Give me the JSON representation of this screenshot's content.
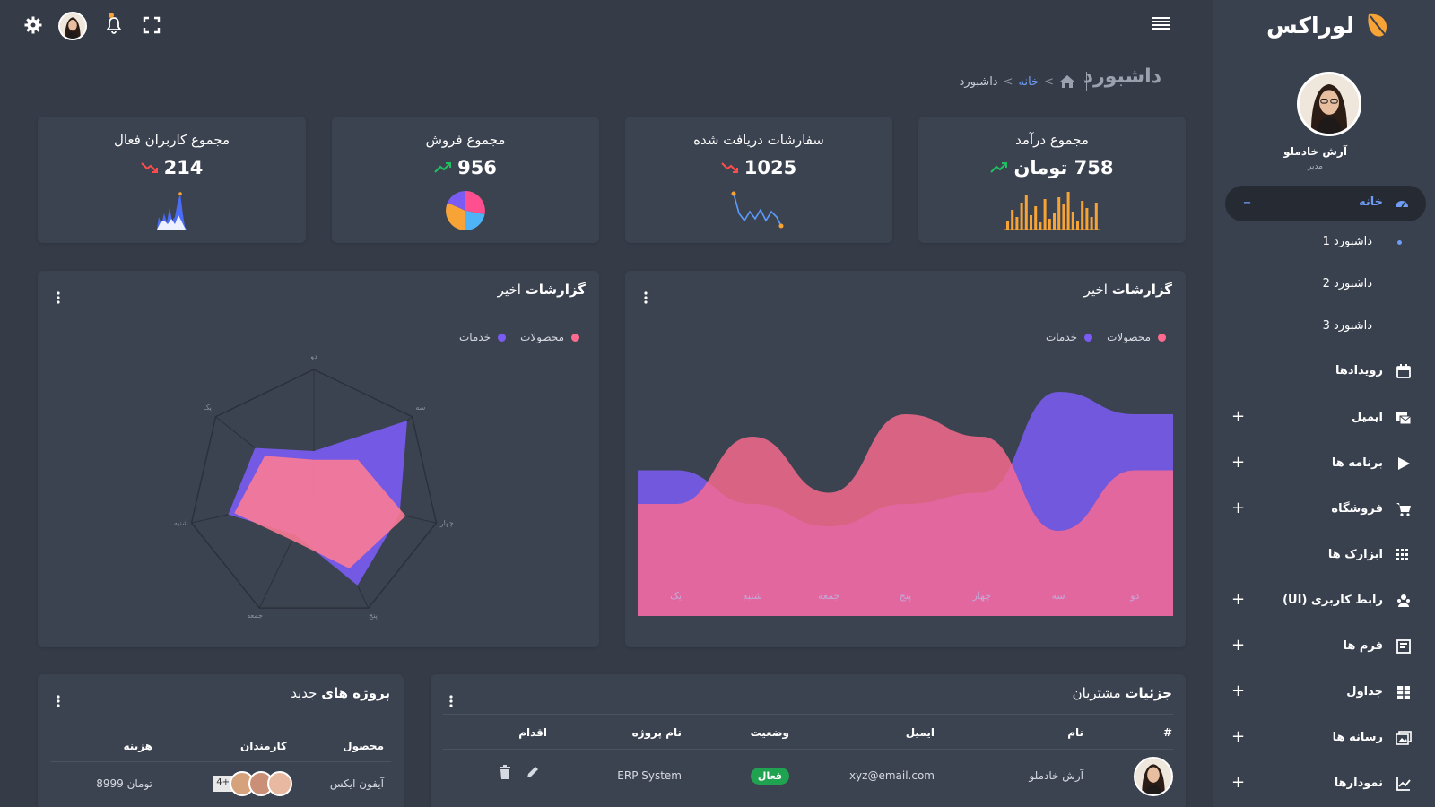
{
  "brand": {
    "name": "لوراکس"
  },
  "profile": {
    "name": "آرش خادملو",
    "role": "مدیر"
  },
  "sidebar": {
    "home": {
      "label": "خانه",
      "icon": "dashboard-icon"
    },
    "subitems": [
      {
        "label": "داشبورد 1"
      },
      {
        "label": "داشبورد 2"
      },
      {
        "label": "داشبورد 3"
      }
    ],
    "items": [
      {
        "label": "رویدادها",
        "icon": "calendar-icon",
        "expandable": false
      },
      {
        "label": "ایمیل",
        "icon": "email-icon",
        "expandable": true
      },
      {
        "label": "برنامه ها",
        "icon": "apps-icon",
        "expandable": true
      },
      {
        "label": "فروشگاه",
        "icon": "cart-icon",
        "expandable": true
      },
      {
        "label": "ابزارک ها",
        "icon": "widgets-icon",
        "expandable": false
      },
      {
        "label": "رابط کاربری (UI)",
        "icon": "ui-icon",
        "expandable": true
      },
      {
        "label": "فرم ها",
        "icon": "forms-icon",
        "expandable": true
      },
      {
        "label": "جداول",
        "icon": "table-icon",
        "expandable": true
      },
      {
        "label": "رسانه ها",
        "icon": "media-icon",
        "expandable": true
      },
      {
        "label": "نمودارها",
        "icon": "chart-icon",
        "expandable": true
      }
    ],
    "plus_symbol": "+",
    "minus_symbol": "–"
  },
  "header": {
    "page_title": "داشبورد",
    "breadcrumb": {
      "home": "خانه",
      "separator": ">",
      "current": "داشبورد"
    }
  },
  "stats": [
    {
      "title": "مجموع درآمد",
      "value": "758 تومان",
      "trend": "up"
    },
    {
      "title": "سفارشات دریافت شده",
      "value": "1025",
      "trend": "down"
    },
    {
      "title": "مجموع فروش",
      "value": "956",
      "trend": "up"
    },
    {
      "title": "مجموع کاربران فعال",
      "value": "214",
      "trend": "down"
    }
  ],
  "area_card": {
    "title_bold": "گزارشات",
    "title_rest": "اخیر",
    "legend": [
      "محصولات",
      "خدمات"
    ]
  },
  "radar_card": {
    "title_bold": "گزارشات",
    "title_rest": "اخیر",
    "legend": [
      "محصولات",
      "خدمات"
    ]
  },
  "customers": {
    "title_bold": "جزئیات",
    "title_rest": "مشتریان",
    "headers": [
      "#",
      "نام",
      "ایمیل",
      "وضعیت",
      "نام پروژه",
      "اقدام"
    ],
    "rows": [
      {
        "name": "آرش خادملو",
        "email": "xyz@email.com",
        "status": "فعال",
        "project": "ERP System"
      }
    ]
  },
  "projects": {
    "title_bold": "پروژه های",
    "title_rest": "جدید",
    "headers": [
      "محصول",
      "کارمندان",
      "هزینه"
    ],
    "rows": [
      {
        "product": "آیفون ایکس",
        "staff_more": "4+",
        "cost": "8999 تومان"
      }
    ]
  },
  "colors": {
    "accent": "#6e9cf7",
    "pink": "#ff6b8f",
    "purple": "#7a5cf5",
    "orange": "#f7a335",
    "green": "#20a351",
    "red": "#ff4d4d"
  },
  "chart_data": [
    {
      "type": "area",
      "x": [
        "دو",
        "سه",
        "چهار",
        "پنج",
        "جمعه",
        "شنبه",
        "یک"
      ],
      "series": [
        {
          "name": "محصولات",
          "values": [
            55,
            28,
            70,
            80,
            45,
            70,
            40
          ]
        },
        {
          "name": "خدمات",
          "values": [
            80,
            90,
            45,
            40,
            30,
            40,
            55
          ]
        }
      ]
    },
    {
      "type": "radar",
      "axes": [
        "دو",
        "سه",
        "چهار",
        "پنج",
        "جمعه",
        "شنبه",
        "یک"
      ],
      "series": [
        {
          "name": "محصولات",
          "values": [
            28,
            45,
            75,
            65,
            40,
            65,
            50
          ]
        },
        {
          "name": "خدمات",
          "values": [
            35,
            95,
            70,
            80,
            35,
            70,
            60
          ]
        }
      ]
    }
  ]
}
